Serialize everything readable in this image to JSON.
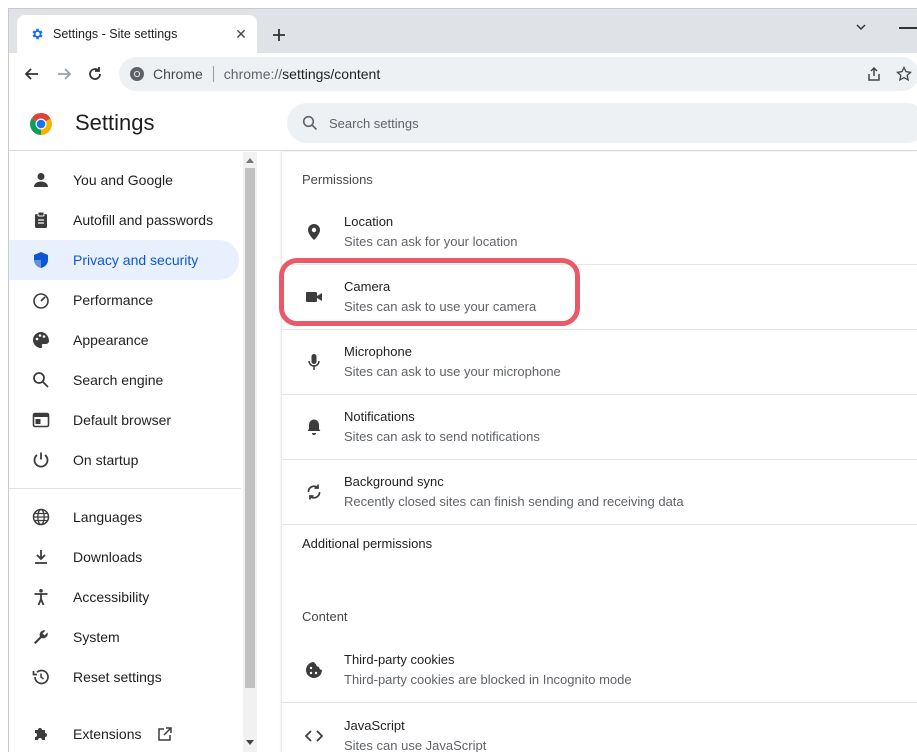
{
  "tab": {
    "title": "Settings - Site settings",
    "close": "✕",
    "favicon_icon": "gear-icon"
  },
  "toolbar": {
    "chip_label": "Chrome",
    "url_scheme": "chrome://",
    "url_path": "settings/content"
  },
  "header": {
    "title": "Settings"
  },
  "search": {
    "placeholder": "Search settings"
  },
  "sidebar": {
    "items": [
      {
        "label": "You and Google",
        "icon": "person-icon"
      },
      {
        "label": "Autofill and passwords",
        "icon": "clipboard-icon"
      },
      {
        "label": "Privacy and security",
        "icon": "shield-icon",
        "active": true
      },
      {
        "label": "Performance",
        "icon": "speedometer-icon"
      },
      {
        "label": "Appearance",
        "icon": "palette-icon"
      },
      {
        "label": "Search engine",
        "icon": "search-icon"
      },
      {
        "label": "Default browser",
        "icon": "browser-icon"
      },
      {
        "label": "On startup",
        "icon": "power-icon"
      },
      {
        "label": "Languages",
        "icon": "globe-icon"
      },
      {
        "label": "Downloads",
        "icon": "download-icon"
      },
      {
        "label": "Accessibility",
        "icon": "accessibility-icon"
      },
      {
        "label": "System",
        "icon": "wrench-icon"
      },
      {
        "label": "Reset settings",
        "icon": "history-icon"
      },
      {
        "label": "Extensions",
        "icon": "puzzle-icon"
      }
    ]
  },
  "main": {
    "permissions_heading": "Permissions",
    "permissions": [
      {
        "title": "Location",
        "subtitle": "Sites can ask for your location",
        "icon": "location-pin-icon"
      },
      {
        "title": "Camera",
        "subtitle": "Sites can ask to use your camera",
        "icon": "camera-icon"
      },
      {
        "title": "Microphone",
        "subtitle": "Sites can ask to use your microphone",
        "icon": "microphone-icon"
      },
      {
        "title": "Notifications",
        "subtitle": "Sites can ask to send notifications",
        "icon": "bell-icon"
      },
      {
        "title": "Background sync",
        "subtitle": "Recently closed sites can finish sending and receiving data",
        "icon": "sync-icon"
      }
    ],
    "additional_heading": "Additional permissions",
    "content_heading": "Content",
    "content": [
      {
        "title": "Third-party cookies",
        "subtitle": "Third-party cookies are blocked in Incognito mode",
        "icon": "cookie-icon"
      },
      {
        "title": "JavaScript",
        "subtitle": "Sites can use JavaScript",
        "icon": "code-icon"
      }
    ]
  },
  "colors": {
    "highlight": "#e95a68",
    "active_bg": "#e8f0fd",
    "active_text": "#0b57d0"
  }
}
